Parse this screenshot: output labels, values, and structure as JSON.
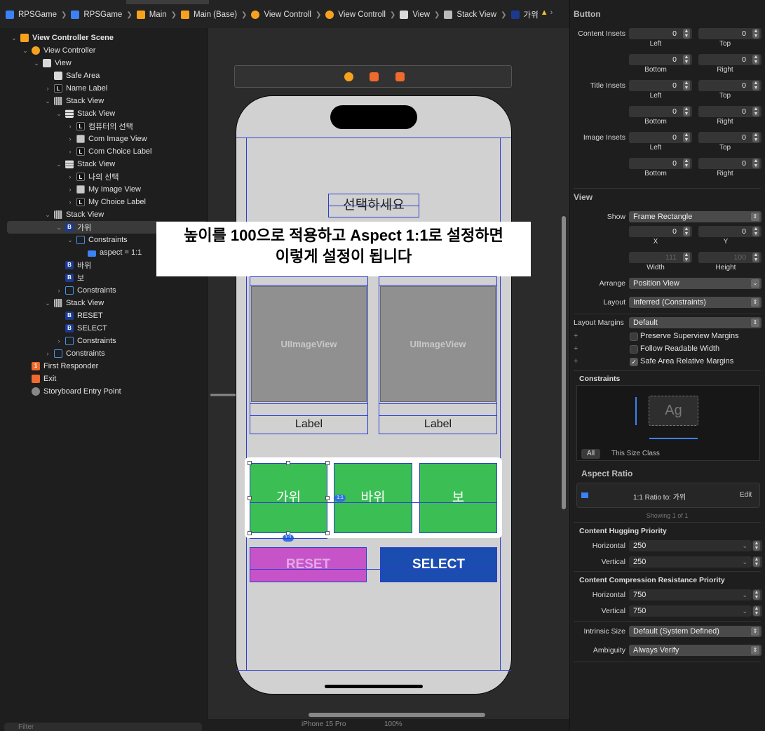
{
  "breadcrumbs": [
    "RPSGame",
    "RPSGame",
    "Main",
    "Main (Base)",
    "View Controll",
    "View Controll",
    "View",
    "Stack View",
    "가위"
  ],
  "outline": [
    {
      "indent": 0,
      "open": true,
      "icon": "SC",
      "label": "View Controller Scene",
      "bold": true
    },
    {
      "indent": 1,
      "open": true,
      "icon": "VC",
      "label": "View Controller"
    },
    {
      "indent": 2,
      "open": true,
      "icon": "V",
      "label": "View"
    },
    {
      "indent": 3,
      "open": null,
      "icon": "V",
      "label": "Safe Area"
    },
    {
      "indent": 3,
      "open": false,
      "icon": "L",
      "label": "Name Label"
    },
    {
      "indent": 3,
      "open": true,
      "icon": "SV",
      "label": "Stack View"
    },
    {
      "indent": 4,
      "open": true,
      "icon": "HS",
      "label": "Stack View"
    },
    {
      "indent": 5,
      "open": false,
      "icon": "L",
      "label": "컴퓨터의 선택"
    },
    {
      "indent": 5,
      "open": false,
      "icon": "IMG",
      "label": "Com Image View"
    },
    {
      "indent": 5,
      "open": false,
      "icon": "L",
      "label": "Com Choice Label"
    },
    {
      "indent": 4,
      "open": true,
      "icon": "HS",
      "label": "Stack View"
    },
    {
      "indent": 5,
      "open": false,
      "icon": "L",
      "label": "나의 선택"
    },
    {
      "indent": 5,
      "open": false,
      "icon": "IMG",
      "label": "My Image View"
    },
    {
      "indent": 5,
      "open": false,
      "icon": "L",
      "label": "My Choice Label"
    },
    {
      "indent": 3,
      "open": true,
      "icon": "SV",
      "label": "Stack View"
    },
    {
      "indent": 4,
      "open": true,
      "icon": "B",
      "label": "가위",
      "selected": true
    },
    {
      "indent": 5,
      "open": true,
      "icon": "CON",
      "label": "Constraints"
    },
    {
      "indent": 6,
      "open": null,
      "icon": "ASP",
      "label": "aspect = 1:1"
    },
    {
      "indent": 4,
      "open": null,
      "icon": "B",
      "label": "바위"
    },
    {
      "indent": 4,
      "open": null,
      "icon": "B",
      "label": "보"
    },
    {
      "indent": 4,
      "open": false,
      "icon": "CON",
      "label": "Constraints"
    },
    {
      "indent": 3,
      "open": true,
      "icon": "SV",
      "label": "Stack View"
    },
    {
      "indent": 4,
      "open": null,
      "icon": "B",
      "label": "RESET"
    },
    {
      "indent": 4,
      "open": null,
      "icon": "B",
      "label": "SELECT"
    },
    {
      "indent": 4,
      "open": false,
      "icon": "CON",
      "label": "Constraints"
    },
    {
      "indent": 3,
      "open": false,
      "icon": "CON",
      "label": "Constraints"
    },
    {
      "indent": 1,
      "open": null,
      "icon": "FR",
      "label": "First Responder"
    },
    {
      "indent": 1,
      "open": null,
      "icon": "EX",
      "label": "Exit"
    },
    {
      "indent": 1,
      "open": null,
      "icon": "EP",
      "label": "Storyboard Entry Point"
    }
  ],
  "filter_placeholder": "Filter",
  "canvas": {
    "title": "선택하세요",
    "overlay_line1": "높이를 100으로 적용하고 Aspect 1:1로 설정하면",
    "overlay_line2": "이렇게 설정이 됩니다",
    "image_placeholder": "UIImageView",
    "label": "Label",
    "buttons": [
      "가위",
      "바위",
      "보"
    ],
    "reset": "RESET",
    "select": "SELECT",
    "ratio_badge": "1:1",
    "device": "iPhone 15 Pro",
    "zoom": "100%"
  },
  "inspector": {
    "button_header": "Button",
    "content_insets": "Content Insets",
    "title_insets": "Title Insets",
    "image_insets": "Image Insets",
    "left": "Left",
    "top": "Top",
    "bottom": "Bottom",
    "right": "Right",
    "zero": "0",
    "view_header": "View",
    "show_label": "Show",
    "show_value": "Frame Rectangle",
    "x_value": "0",
    "y_value": "0",
    "x_label": "X",
    "y_label": "Y",
    "width_value": "111",
    "height_value": "100",
    "width_label": "Width",
    "height_label": "Height",
    "arrange_label": "Arrange",
    "arrange_value": "Position View",
    "layout_label": "Layout",
    "layout_value": "Inferred (Constraints)",
    "margins_label": "Layout Margins",
    "margins_value": "Default",
    "preserve": "Preserve Superview Margins",
    "readable": "Follow Readable Width",
    "safearea": "Safe Area Relative Margins",
    "constraints_header": "Constraints",
    "ag": "Ag",
    "seg_all": "All",
    "seg_size": "This Size Class",
    "aspect_header": "Aspect Ratio",
    "aspect_desc": "1:1 Ratio to:  가위",
    "edit": "Edit",
    "showing": "Showing 1 of 1",
    "hugging_header": "Content Hugging Priority",
    "compression_header": "Content Compression Resistance Priority",
    "horizontal": "Horizontal",
    "vertical": "Vertical",
    "hug_h": "250",
    "hug_v": "250",
    "comp_h": "750",
    "comp_v": "750",
    "intrinsic_label": "Intrinsic Size",
    "intrinsic_value": "Default (System Defined)",
    "ambiguity_label": "Ambiguity",
    "ambiguity_value": "Always Verify"
  }
}
